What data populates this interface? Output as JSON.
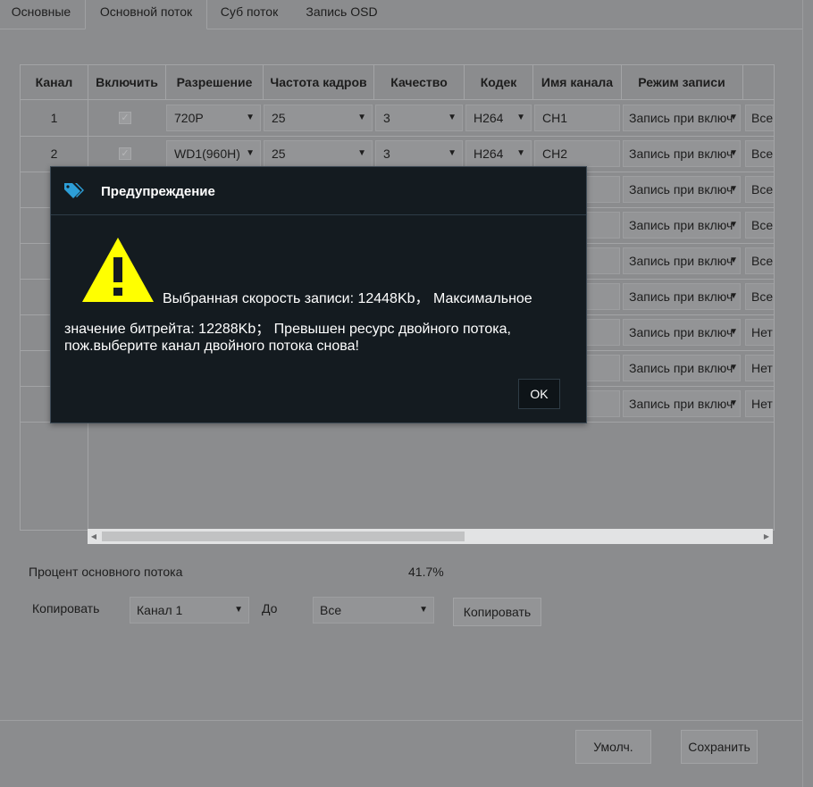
{
  "tabs": [
    {
      "label": "Основные",
      "active": false
    },
    {
      "label": "Основной поток",
      "active": true
    },
    {
      "label": "Суб поток",
      "active": false
    },
    {
      "label": "Запись OSD",
      "active": false
    }
  ],
  "table": {
    "headers": [
      "Канал",
      "Включить",
      "Разрешение",
      "Частота кадров",
      "Качество",
      "Кодек",
      "Имя канала",
      "Режим записи"
    ],
    "rows": [
      {
        "channel": "1",
        "enabled": true,
        "resolution": "720P",
        "fps": "25",
        "quality": "3",
        "codec": "H264",
        "name": "CH1",
        "mode": "Запись при включ",
        "extra": "Все"
      },
      {
        "channel": "2",
        "enabled": true,
        "resolution": "WD1(960H)",
        "fps": "25",
        "quality": "3",
        "codec": "H264",
        "name": "CH2",
        "mode": "Запись при включ",
        "extra": "Все"
      },
      {
        "mode": "Запись при включ",
        "extra": "Все"
      },
      {
        "mode": "Запись при включ",
        "extra": "Все"
      },
      {
        "mode": "Запись при включ",
        "extra": "Все"
      },
      {
        "mode": "Запись при включ",
        "extra": "Все"
      },
      {
        "mode": "Запись при включ",
        "extra": "Нет"
      },
      {
        "mode": "Запись при включ",
        "extra": "Нет"
      },
      {
        "mode": "Запись при включ",
        "extra": "Нет"
      }
    ]
  },
  "bottom": {
    "percent_label": "Процент основного потока",
    "percent_value": "41.7%",
    "copy_label": "Копировать",
    "copy_from": "Канал 1",
    "to_label": "До",
    "copy_to": "Все",
    "copy_button": "Копировать"
  },
  "footer": {
    "default_button": "Умолч.",
    "save_button": "Сохранить"
  },
  "dialog": {
    "title": "Предупреждение",
    "message_line1": "Выбранная скорость записи: 12448Kb，  Максимальное",
    "message_line2": "значение битрейта: 12288Kb；  Превышен ресурс двойного потока, пож.выберите канал двойного потока снова!",
    "ok_button": "OK"
  },
  "colors": {
    "dialog_bg": "#141b20",
    "warning_yellow": "#ffff00",
    "tag_icon": "#2d9fd8",
    "page_bg": "#8b8c8e"
  }
}
